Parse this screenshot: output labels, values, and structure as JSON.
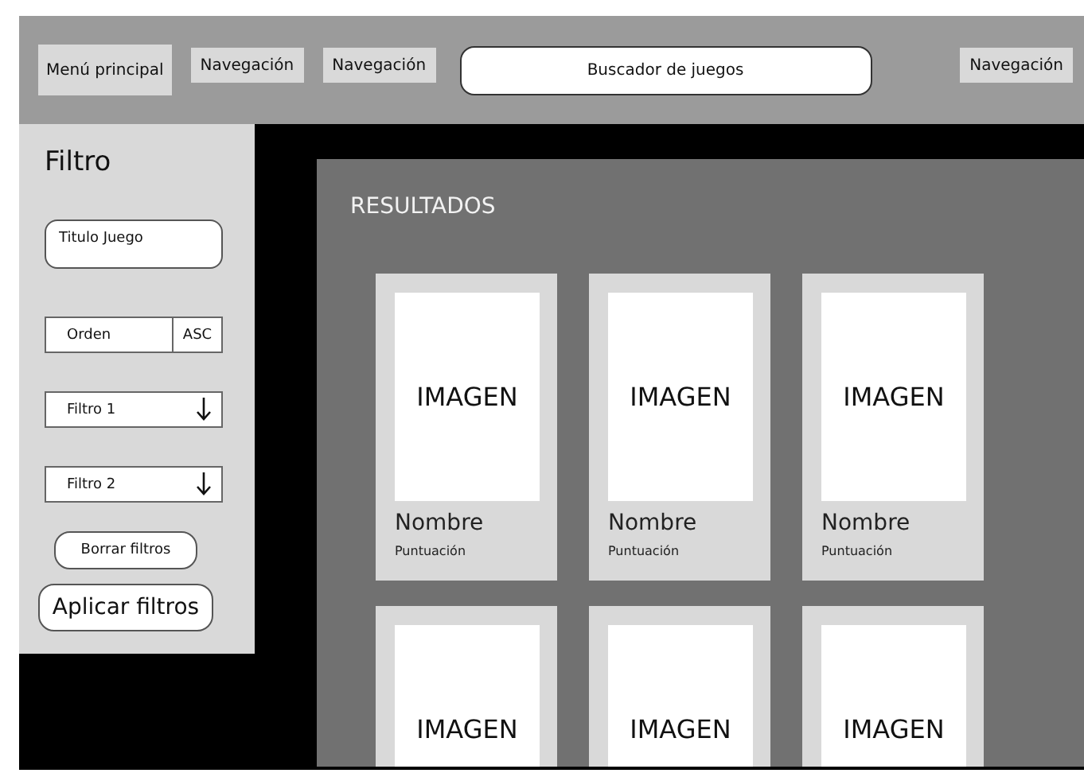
{
  "top_bar": {
    "items": [
      {
        "kind": "menu",
        "label": "Menú principal"
      },
      {
        "kind": "nav",
        "label": "Navegación"
      },
      {
        "kind": "nav",
        "label": "Navegación"
      },
      {
        "kind": "search",
        "placeholder": "Buscador de juegos"
      },
      {
        "kind": "nav",
        "label": "Navegación"
      }
    ]
  },
  "sidebar": {
    "title": "Filtro",
    "controls": [
      {
        "kind": "field",
        "placeholder": "Titulo Juego"
      },
      {
        "kind": "sort",
        "label": "Orden",
        "toggle": "ASC"
      },
      {
        "kind": "dropdown",
        "label": "Filtro 1"
      },
      {
        "kind": "dropdown",
        "label": "Filtro 2"
      },
      {
        "kind": "small_button",
        "label": "Borrar filtros"
      },
      {
        "kind": "big_button",
        "label": "Aplicar filtros"
      }
    ]
  },
  "results": {
    "title": "RESULTADOS",
    "cards": [
      {
        "image_label": "IMAGEN",
        "name": "Nombre",
        "score": "Puntuación"
      },
      {
        "image_label": "IMAGEN",
        "name": "Nombre",
        "score": "Puntuación"
      },
      {
        "image_label": "IMAGEN",
        "name": "Nombre",
        "score": "Puntuación"
      },
      {
        "image_label": "IMAGEN"
      },
      {
        "image_label": "IMAGEN"
      },
      {
        "image_label": "IMAGEN"
      }
    ]
  }
}
